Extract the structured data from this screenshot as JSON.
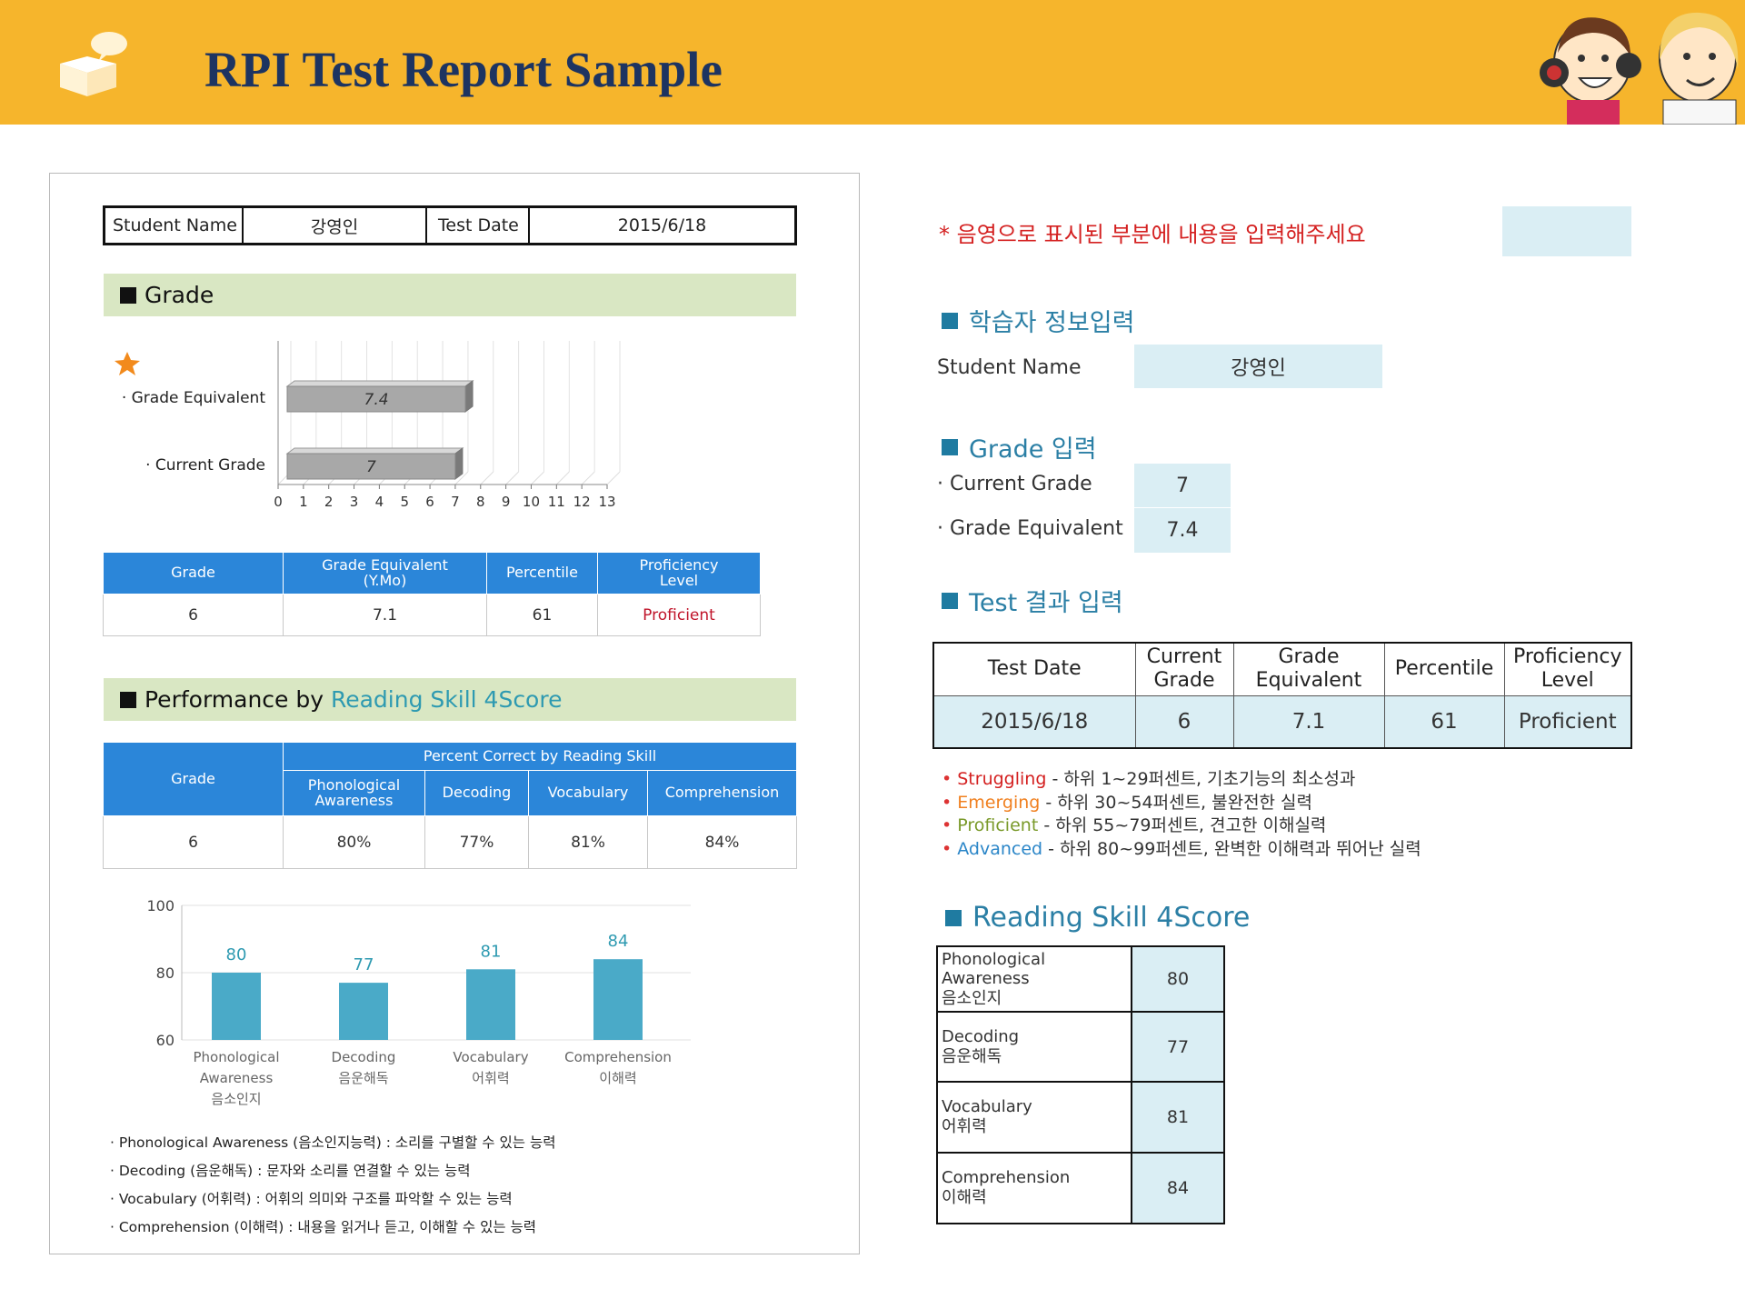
{
  "header": {
    "title": "RPI Test Report  Sample"
  },
  "report": {
    "student_name_label": "Student Name",
    "student_name": "강영인",
    "test_date_label": "Test Date",
    "test_date": "2015/6/18",
    "grade_section": "Grade",
    "grade_chart": {
      "type": "bar",
      "orientation": "horizontal",
      "categories": [
        "Grade Equivalent",
        "Current Grade"
      ],
      "values": [
        7.4,
        7
      ],
      "value_labels": [
        "7.4",
        "7"
      ],
      "xlim": [
        0,
        13
      ],
      "ticks": [
        "0",
        "1",
        "2",
        "3",
        "4",
        "5",
        "6",
        "7",
        "8",
        "9",
        "10",
        "11",
        "12",
        "13"
      ]
    },
    "grade_table": {
      "headers": [
        "Grade",
        "Grade Equivalent\n(Y.Mo)",
        "Percentile",
        "Proficiency\nLevel"
      ],
      "row": [
        "6",
        "7.1",
        "61",
        "Proficient"
      ]
    },
    "perf_section": {
      "prefix": "Performance by ",
      "highlight": "Reading Skill 4Score"
    },
    "perf_table": {
      "grade_header": "Grade",
      "group_header": "Percent Correct by Reading Skill",
      "skill_headers": [
        "Phonological\nAwareness",
        "Decoding",
        "Vocabulary",
        "Comprehension"
      ],
      "row": [
        "6",
        "80%",
        "77%",
        "81%",
        "84%"
      ]
    },
    "perf_chart": {
      "type": "bar",
      "categories": [
        "Phonological\nAwareness\n음소인지",
        "Decoding\n음운해독",
        "Vocabulary\n어휘력",
        "Comprehension\n이해력"
      ],
      "values": [
        80,
        77,
        81,
        84
      ],
      "ylim": [
        60,
        100
      ],
      "yticks": [
        "60",
        "80",
        "100"
      ],
      "bar_color": "#4aaac8"
    },
    "notes": [
      "Phonological Awareness (음소인지능력) : 소리를 구별할 수 있는 능력",
      "Decoding (음운해독) : 문자와 소리를 연결할 수 있는 능력",
      "Vocabulary (어휘력) : 어휘의 의미와 구조를 파악할 수 있는 능력",
      "Comprehension (이해력) : 내용을 읽거나 듣고, 이해할 수 있는 능력"
    ]
  },
  "panel": {
    "instruction": "* 음영으로 표시된 부분에 내용을 입력해주세요",
    "learner_heading": "학습자 정보입력",
    "student_name_label": "Student Name",
    "student_name": "강영인",
    "grade_heading": "Grade 입력",
    "current_grade_label": "Current Grade",
    "current_grade": "7",
    "grade_equiv_label": "Grade Equivalent",
    "grade_equiv": "7.4",
    "test_heading": "Test 결과 입력",
    "test_table": {
      "headers": [
        "Test Date",
        "Current\nGrade",
        "Grade\nEquivalent",
        "Percentile",
        "Proficiency\nLevel"
      ],
      "row": [
        "2015/6/18",
        "6",
        "7.1",
        "61",
        "Proficient"
      ]
    },
    "legend": [
      {
        "term": "Struggling",
        "desc": " - 하위 1~29퍼센트, 기초기능의 최소성과",
        "color": "#d42020"
      },
      {
        "term": "Emerging",
        "desc": " - 하위 30~54퍼센트, 불완전한 실력",
        "color": "#f08020"
      },
      {
        "term": "Proficient",
        "desc": " - 하위 55~79퍼센트, 견고한 이해실력",
        "color": "#7a9a2a"
      },
      {
        "term": "Advanced",
        "desc": " - 하위 80~99퍼센트, 완벽한 이해력과 뛰어난 실력",
        "color": "#2b86c8"
      }
    ],
    "skill_heading": "Reading Skill 4Score",
    "skills": [
      {
        "label": "Phonological\nAwareness\n음소인지",
        "value": "80"
      },
      {
        "label": "Decoding\n음운해독",
        "value": "77"
      },
      {
        "label": "Vocabulary\n어휘력",
        "value": "81"
      },
      {
        "label": "Comprehension\n이해력",
        "value": "84"
      }
    ]
  },
  "colors": {
    "header_bg": "#f6b52c",
    "title": "#1d3461",
    "table_header": "#2b86d9",
    "input_bg": "#daeef4",
    "section_bg": "#d9e7c3"
  }
}
